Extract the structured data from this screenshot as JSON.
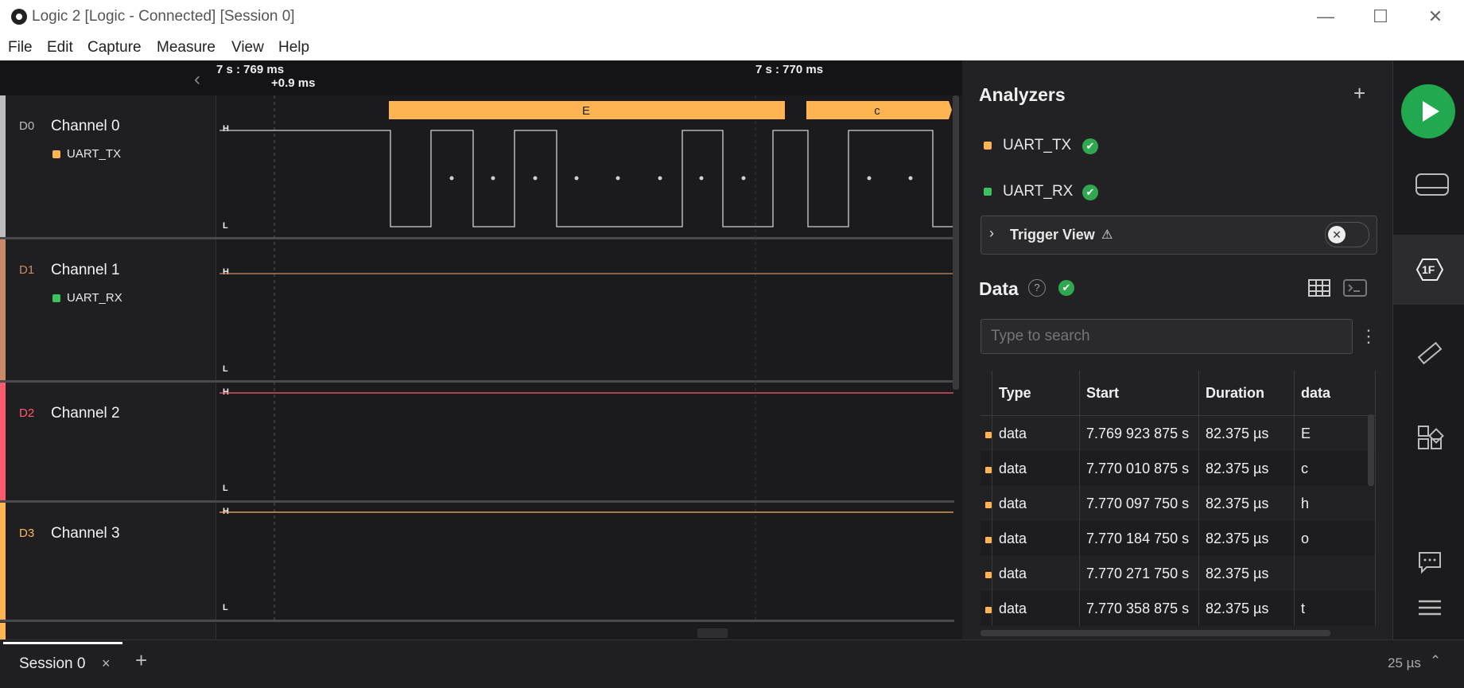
{
  "window": {
    "title": "Logic 2 [Logic - Connected] [Session 0]",
    "minimize": "—",
    "maximize": "☐",
    "close": "✕"
  },
  "menu": [
    "File",
    "Edit",
    "Capture",
    "Measure",
    "View",
    "Help"
  ],
  "ruler": {
    "left_time": "7 s : 769 ms",
    "offset": "+0.9 ms",
    "right_time": "7 s : 770 ms"
  },
  "channels": [
    {
      "id": "D0",
      "name": "Channel 0",
      "analyzer": "UART_TX",
      "color": "#bdbdbd",
      "analyzer_color": "#ffb454"
    },
    {
      "id": "D1",
      "name": "Channel 1",
      "analyzer": "UART_RX",
      "color": "#c98a6a",
      "analyzer_color": "#3cc25a"
    },
    {
      "id": "D2",
      "name": "Channel 2",
      "color": "#ff5a6e"
    },
    {
      "id": "D3",
      "name": "Channel 3",
      "color": "#ffb454"
    }
  ],
  "levels": {
    "high": "H",
    "low": "L"
  },
  "decoded": [
    {
      "label": "E"
    },
    {
      "label": "c"
    }
  ],
  "analyzers_panel": {
    "title": "Analyzers",
    "add": "+",
    "items": [
      {
        "name": "UART_TX",
        "color": "#ffb454"
      },
      {
        "name": "UART_RX",
        "color": "#3cc25a"
      }
    ],
    "trigger_view": "Trigger View",
    "trigger_warning": "⚠"
  },
  "data_panel": {
    "title": "Data",
    "help": "?",
    "search_placeholder": "Type to search",
    "more": "⋮",
    "columns": [
      "Type",
      "Start",
      "Duration",
      "data"
    ],
    "rows": [
      {
        "type": "data",
        "start": "7.769 923 875 s",
        "duration": "82.375 µs",
        "data": "E"
      },
      {
        "type": "data",
        "start": "7.770 010 875 s",
        "duration": "82.375 µs",
        "data": "c"
      },
      {
        "type": "data",
        "start": "7.770 097 750 s",
        "duration": "82.375 µs",
        "data": "h"
      },
      {
        "type": "data",
        "start": "7.770 184 750 s",
        "duration": "82.375 µs",
        "data": "o"
      },
      {
        "type": "data",
        "start": "7.770 271 750 s",
        "duration": "82.375 µs",
        "data": ""
      },
      {
        "type": "data",
        "start": "7.770 358 875 s",
        "duration": "82.375 µs",
        "data": "t"
      }
    ]
  },
  "sidebar": {
    "ext_label": "1F"
  },
  "bottom": {
    "session_tab": "Session 0",
    "close_tab": "×",
    "add_tab": "+",
    "zoom": "25 µs"
  },
  "colors": {
    "accent_green": "#22a94f",
    "accent_orange": "#ffb454"
  }
}
